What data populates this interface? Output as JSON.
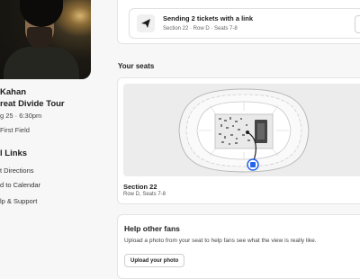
{
  "event": {
    "artist": "Kahan",
    "tour": "reat Divide Tour",
    "datetime": "g 25 · 6:30pm",
    "venue": "First Field"
  },
  "useful_links": {
    "title": "l Links",
    "items": [
      {
        "label": "t Directions",
        "icon": "directions-icon"
      },
      {
        "label": "d to Calendar",
        "icon": "calendar-icon"
      },
      {
        "label": "lp & Support",
        "icon": "support-icon"
      }
    ]
  },
  "transfer": {
    "title": "Sending 2 tickets with a link",
    "details": "Section 22 · Row D · Seats 7-8",
    "icon": "send-icon"
  },
  "seats": {
    "heading": "Your seats",
    "section": "Section 22",
    "row_seats": "Row D, Seats 7-8"
  },
  "help": {
    "title": "Help other fans",
    "description": "Upload a photo from your seat to help fans see what the view is really like.",
    "button": "Upload your photo"
  },
  "colors": {
    "seat_marker": "#2563eb",
    "map_background": "#ececec"
  }
}
